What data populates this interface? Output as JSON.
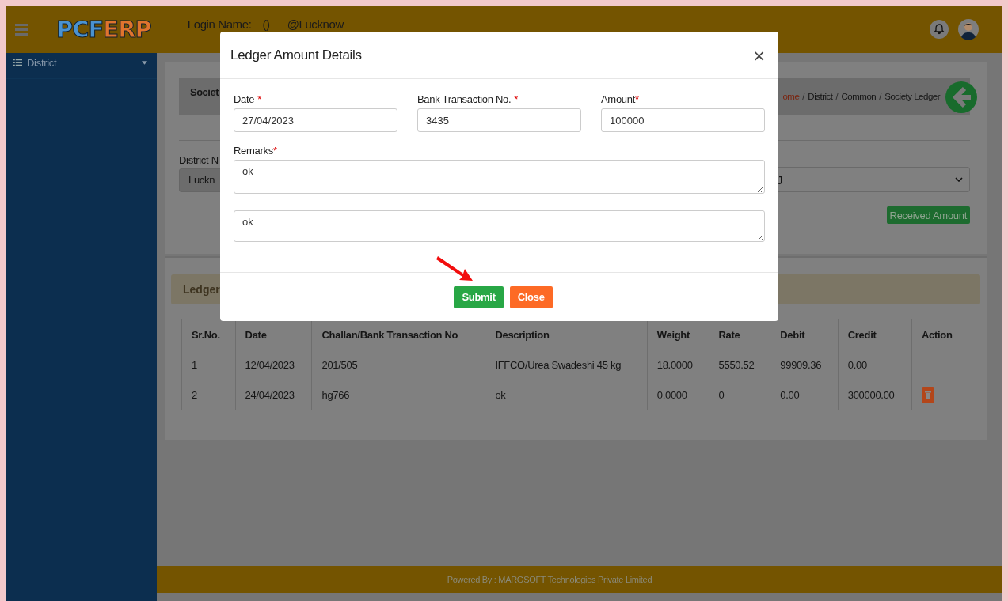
{
  "header": {
    "logo": [
      "PCF",
      "ERP"
    ],
    "login_label": "Login Name:",
    "login_name": "()",
    "location": "@Lucknow"
  },
  "sidebar": {
    "items": [
      {
        "label": "District",
        "expanded": false
      }
    ]
  },
  "page": {
    "title": "Societ",
    "breadcrumb_separator": "/",
    "breadcrumb": [
      {
        "label": "ome",
        "active": true
      },
      {
        "label": "District",
        "active": false
      },
      {
        "label": "Common",
        "active": false
      },
      {
        "label": "Society Ledger",
        "active": false
      }
    ],
    "district_label": "District N",
    "district_value": "Luckn",
    "society_value": "J",
    "received_button": "Received Amount",
    "ledger_heading": "Ledger"
  },
  "table": {
    "columns": [
      "Sr.No.",
      "Date",
      "Challan/Bank Transaction No",
      "Description",
      "Weight",
      "Rate",
      "Debit",
      "Credit",
      "Action"
    ],
    "rows": [
      {
        "cells": [
          "1",
          "12/04/2023",
          "201/505",
          "IFFCO/Urea Swadeshi 45 kg",
          "18.0000",
          "5550.52",
          "99909.36",
          "0.00"
        ],
        "deletable": false
      },
      {
        "cells": [
          "2",
          "24/04/2023",
          "hg766",
          "ok",
          "0.0000",
          "0",
          "0.00",
          "300000.00"
        ],
        "deletable": true
      }
    ]
  },
  "footer": "Powered By : MARGSOFT Technologies Private Limited",
  "modal": {
    "title": "Ledger Amount Details",
    "close": "×",
    "fields": [
      {
        "label": "Date",
        "required": "*",
        "value": "27/04/2023"
      },
      {
        "label": "Bank Transaction No.",
        "required": "*",
        "value": "3435"
      },
      {
        "label": "Amount",
        "required": "*",
        "value": "100000"
      }
    ],
    "remarks_label": "Remarks",
    "remarks_required": "*",
    "remarks": [
      "ok",
      "ok"
    ],
    "buttons": [
      {
        "label": "Submit",
        "kind": "primary"
      },
      {
        "label": "Close",
        "kind": "cancel"
      }
    ]
  }
}
